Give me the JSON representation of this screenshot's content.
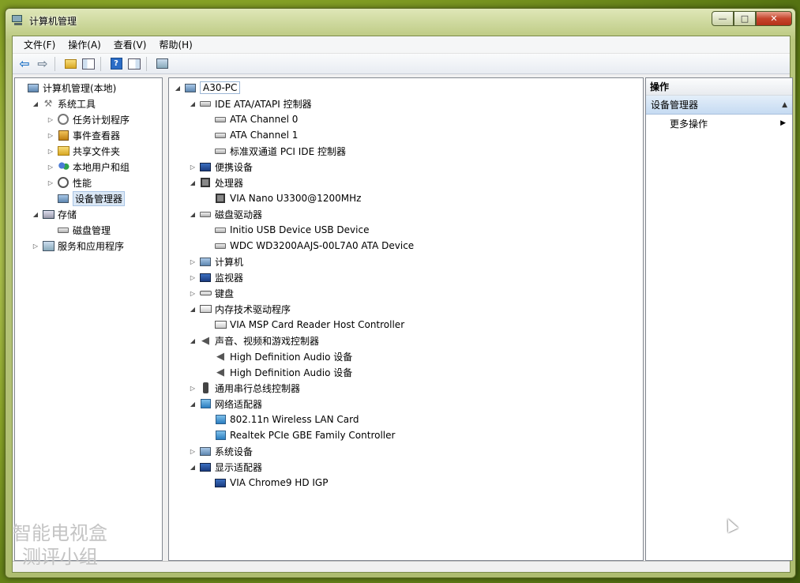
{
  "window": {
    "title": "计算机管理",
    "buttons": {
      "minimize": "—",
      "maximize": "□",
      "close": "✕"
    }
  },
  "menubar": [
    "文件(F)",
    "操作(A)",
    "查看(V)",
    "帮助(H)"
  ],
  "toolbar": {
    "items": [
      "back-arrow-icon",
      "forward-arrow-icon",
      "up-folder-icon",
      "show-hide-console-tree-icon",
      "help-icon",
      "show-hide-action-pane-icon",
      "scan-hardware-icon"
    ]
  },
  "left_tree": [
    {
      "label": "计算机管理(本地)",
      "level": 0,
      "icon": "computer-management-icon",
      "expander": "",
      "selected": false
    },
    {
      "label": "系统工具",
      "level": 1,
      "icon": "tools-icon",
      "expander": "◢",
      "selected": false
    },
    {
      "label": "任务计划程序",
      "level": 2,
      "icon": "clock-icon",
      "expander": "▷",
      "selected": false
    },
    {
      "label": "事件查看器",
      "level": 2,
      "icon": "event-viewer-icon",
      "expander": "▷",
      "selected": false
    },
    {
      "label": "共享文件夹",
      "level": 2,
      "icon": "shared-folder-icon",
      "expander": "▷",
      "selected": false
    },
    {
      "label": "本地用户和组",
      "level": 2,
      "icon": "users-icon",
      "expander": "▷",
      "selected": false
    },
    {
      "label": "性能",
      "level": 2,
      "icon": "performance-icon",
      "expander": "▷",
      "selected": false
    },
    {
      "label": "设备管理器",
      "level": 2,
      "icon": "device-manager-icon",
      "expander": "",
      "selected": true
    },
    {
      "label": "存储",
      "level": 1,
      "icon": "storage-icon",
      "expander": "◢",
      "selected": false
    },
    {
      "label": "磁盘管理",
      "level": 2,
      "icon": "disk-management-icon",
      "expander": "",
      "selected": false
    },
    {
      "label": "服务和应用程序",
      "level": 1,
      "icon": "services-icon",
      "expander": "▷",
      "selected": false
    }
  ],
  "device_tree": [
    {
      "label": "A30-PC",
      "level": 0,
      "icon": "computer-icon",
      "expander": "◢"
    },
    {
      "label": "IDE ATA/ATAPI 控制器",
      "level": 1,
      "icon": "ide-controller-icon",
      "expander": "◢"
    },
    {
      "label": "ATA Channel 0",
      "level": 2,
      "icon": "ide-channel-icon",
      "expander": ""
    },
    {
      "label": "ATA Channel 1",
      "level": 2,
      "icon": "ide-channel-icon",
      "expander": ""
    },
    {
      "label": "标准双通道 PCI IDE 控制器",
      "level": 2,
      "icon": "ide-channel-icon",
      "expander": ""
    },
    {
      "label": "便携设备",
      "level": 1,
      "icon": "portable-device-icon",
      "expander": "▷"
    },
    {
      "label": "处理器",
      "level": 1,
      "icon": "processor-icon",
      "expander": "◢"
    },
    {
      "label": "VIA Nano U3300@1200MHz",
      "level": 2,
      "icon": "processor-icon",
      "expander": ""
    },
    {
      "label": "磁盘驱动器",
      "level": 1,
      "icon": "disk-drive-icon",
      "expander": "◢"
    },
    {
      "label": "Initio USB Device USB Device",
      "level": 2,
      "icon": "disk-drive-icon",
      "expander": ""
    },
    {
      "label": "WDC WD3200AAJS-00L7A0 ATA Device",
      "level": 2,
      "icon": "disk-drive-icon",
      "expander": ""
    },
    {
      "label": "计算机",
      "level": 1,
      "icon": "computer-icon",
      "expander": "▷"
    },
    {
      "label": "监视器",
      "level": 1,
      "icon": "monitor-icon",
      "expander": "▷"
    },
    {
      "label": "键盘",
      "level": 1,
      "icon": "keyboard-icon",
      "expander": "▷"
    },
    {
      "label": "内存技术驱动程序",
      "level": 1,
      "icon": "memory-tech-icon",
      "expander": "◢"
    },
    {
      "label": "VIA MSP Card Reader Host Controller",
      "level": 2,
      "icon": "card-reader-icon",
      "expander": ""
    },
    {
      "label": "声音、视频和游戏控制器",
      "level": 1,
      "icon": "speaker-icon",
      "expander": "◢"
    },
    {
      "label": "High Definition Audio 设备",
      "level": 2,
      "icon": "speaker-icon",
      "expander": ""
    },
    {
      "label": "High Definition Audio 设备",
      "level": 2,
      "icon": "speaker-icon",
      "expander": ""
    },
    {
      "label": "通用串行总线控制器",
      "level": 1,
      "icon": "usb-icon",
      "expander": "▷"
    },
    {
      "label": "网络适配器",
      "level": 1,
      "icon": "network-adapter-icon",
      "expander": "◢"
    },
    {
      "label": "802.11n Wireless LAN Card",
      "level": 2,
      "icon": "network-adapter-icon",
      "expander": ""
    },
    {
      "label": "Realtek PCIe GBE Family Controller",
      "level": 2,
      "icon": "network-adapter-icon",
      "expander": ""
    },
    {
      "label": "系统设备",
      "level": 1,
      "icon": "system-device-icon",
      "expander": "▷"
    },
    {
      "label": "显示适配器",
      "level": 1,
      "icon": "display-adapter-icon",
      "expander": "◢"
    },
    {
      "label": "VIA Chrome9 HD IGP",
      "level": 2,
      "icon": "display-adapter-icon",
      "expander": ""
    }
  ],
  "actions": {
    "header": "操作",
    "section": "设备管理器",
    "collapse_glyph": "▲",
    "items": [
      {
        "label": "更多操作",
        "arrow": "▶"
      }
    ]
  },
  "watermark": {
    "line1": "智能电视盒",
    "line2": "测评小组"
  }
}
